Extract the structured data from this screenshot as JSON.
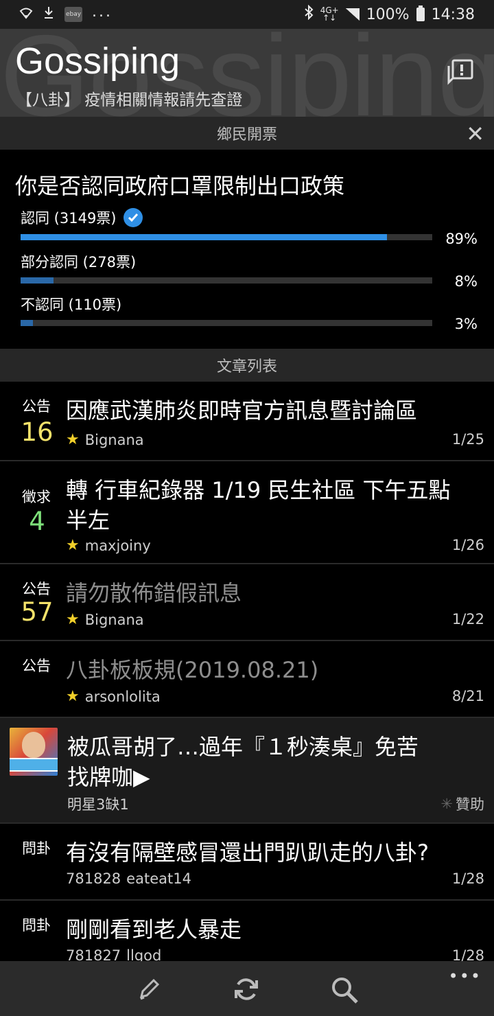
{
  "status_bar": {
    "ebay_label": "ebay",
    "net_top": "4G+",
    "net_bottom": "↑↓",
    "battery_percent": "100%",
    "time": "14:38"
  },
  "header": {
    "watermark": "Gossiping",
    "title": "Gossiping",
    "subtitle": "【八卦】 疫情相關情報請先查證"
  },
  "poll_section": {
    "label": "鄉民開票",
    "close": "✕",
    "question": "你是否認同政府口罩限制出口政策",
    "options": [
      {
        "label": "認同 (3149票)",
        "percent_text": "89%",
        "fraction": 0.89,
        "color": "#2f8fe5",
        "voted": true
      },
      {
        "label": "部分認同 (278票)",
        "percent_text": "8%",
        "fraction": 0.08,
        "color": "#2a68a8",
        "voted": false
      },
      {
        "label": "不認同 (110票)",
        "percent_text": "3%",
        "fraction": 0.03,
        "color": "#2a68a8",
        "voted": false
      }
    ]
  },
  "list_section": {
    "label": "文章列表"
  },
  "articles": [
    {
      "tag": "公告",
      "count": "16",
      "count_color": "#f5e36a",
      "title": "因應武漢肺炎即時官方訊息暨討論區",
      "author": "Bignana",
      "date": "1/25"
    },
    {
      "tag": "徵求",
      "count": "4",
      "count_color": "#7ee07a",
      "title": "轉 行車紀錄器 1/19 民生社區 下午五點半左",
      "author": "maxjoiny",
      "date": "1/26"
    },
    {
      "tag": "公告",
      "count": "57",
      "count_color": "#f5e36a",
      "title": "請勿散佈錯假訊息",
      "author": "Bignana",
      "date": "1/22"
    },
    {
      "tag": "公告",
      "count": "",
      "title": "八卦板板規(2019.08.21)",
      "author": "arsonlolita",
      "date": "8/21"
    }
  ],
  "ad": {
    "title": "被瓜哥胡了…過年『１秒湊桌』免苦找牌咖▶",
    "source": "明星3缺1",
    "sponsor": "贊助"
  },
  "articles2": [
    {
      "tag": "問卦",
      "title": "有沒有隔壁感冒還出門趴趴走的八卦?",
      "id": "781828",
      "author": "eateat14",
      "date": "1/28"
    },
    {
      "tag": "問卦",
      "title": "剛剛看到老人暴走",
      "id": "781827",
      "author": "llgod",
      "date": "1/28"
    }
  ],
  "bottom_bar": {
    "more": "•••"
  },
  "icons": {
    "wifi": "wifi-icon",
    "download": "download-icon",
    "bluetooth": "bluetooth-icon",
    "signal": "signal-icon",
    "battery": "battery-icon",
    "board_info": "board-info-icon",
    "verified": "check-circle-icon",
    "star": "star-icon",
    "pencil": "pencil-icon",
    "refresh": "refresh-icon",
    "search": "search-icon",
    "more": "more-icon"
  }
}
